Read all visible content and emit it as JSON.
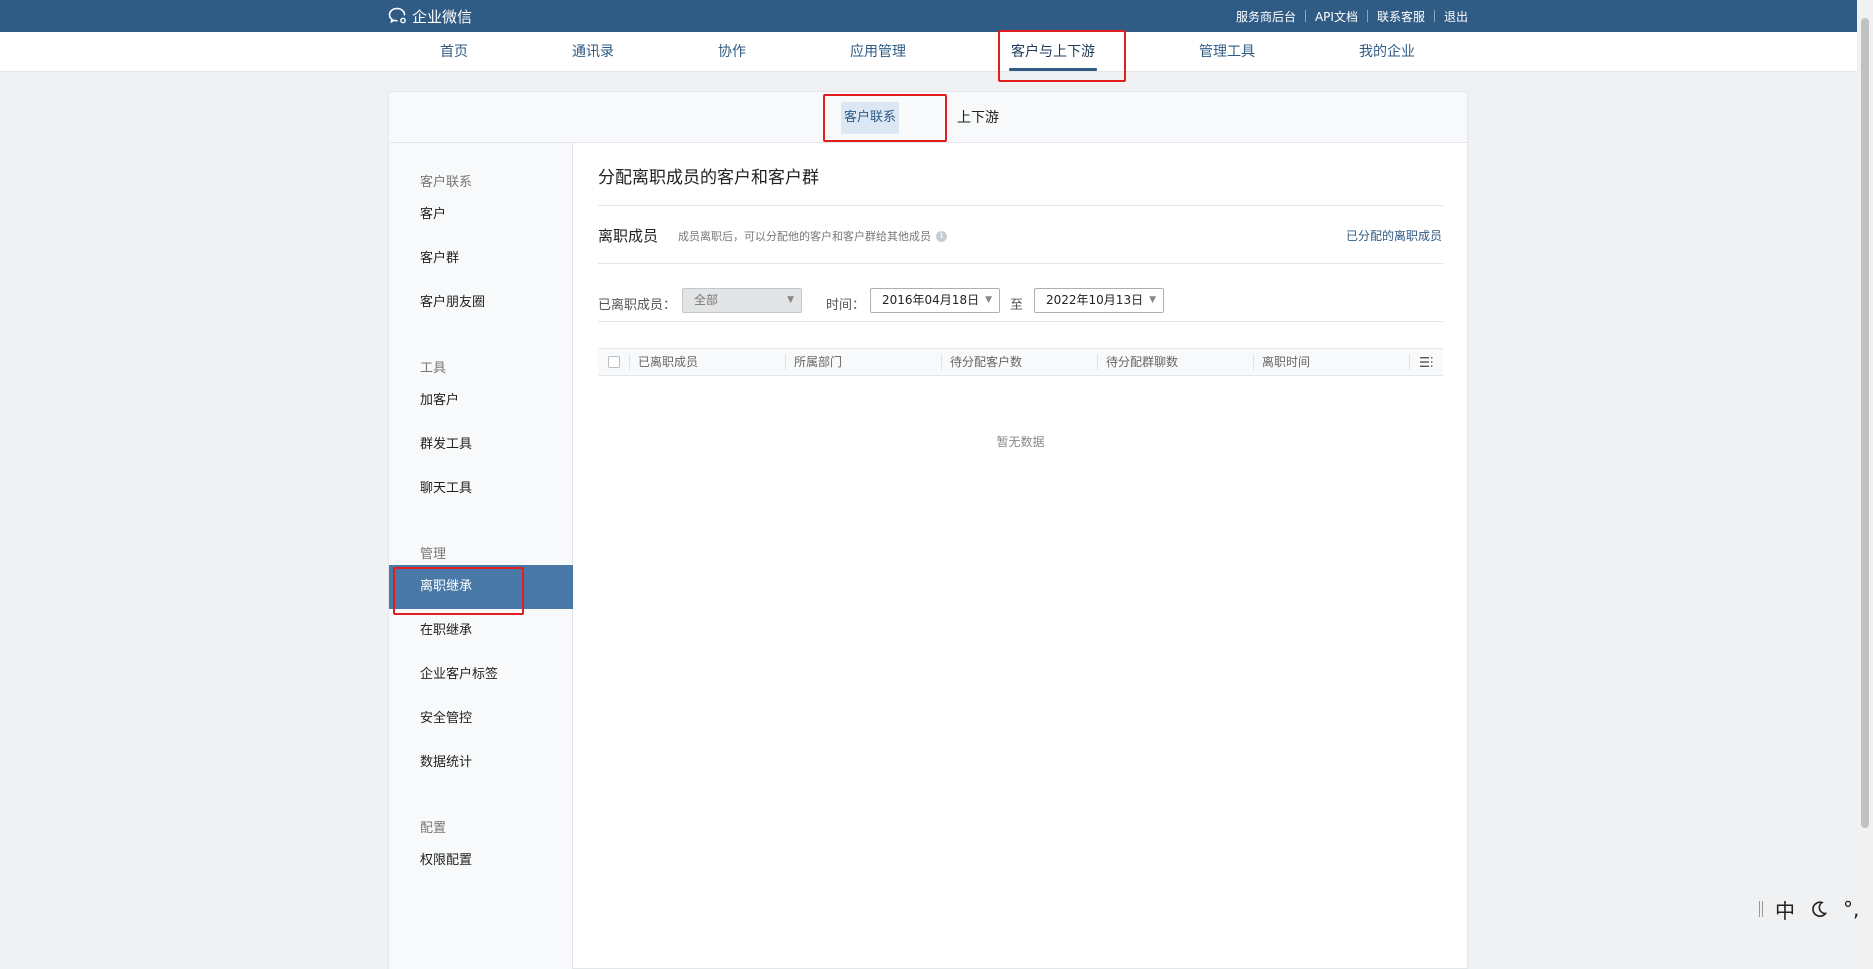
{
  "header": {
    "logo_text": "企业微信",
    "links": [
      "服务商后台",
      "API文档",
      "联系客服",
      "退出"
    ]
  },
  "nav": {
    "items": [
      "首页",
      "通讯录",
      "协作",
      "应用管理",
      "客户与上下游",
      "管理工具",
      "我的企业"
    ],
    "active": "客户与上下游"
  },
  "subnav": {
    "tabs": [
      "客户联系",
      "上下游"
    ],
    "active": "客户联系"
  },
  "sidebar": {
    "groups": [
      {
        "label": "客户联系",
        "items": [
          "客户",
          "客户群",
          "客户朋友圈"
        ]
      },
      {
        "label": "工具",
        "items": [
          "加客户",
          "群发工具",
          "聊天工具"
        ]
      },
      {
        "label": "管理",
        "items": [
          "离职继承",
          "在职继承",
          "企业客户标签",
          "安全管控",
          "数据统计"
        ]
      },
      {
        "label": "配置",
        "items": [
          "权限配置"
        ]
      }
    ],
    "active": "离职继承"
  },
  "main": {
    "title": "分配离职成员的客户和客户群",
    "section_title": "离职成员",
    "section_desc": "成员离职后，可以分配他的客户和客户群给其他成员",
    "section_link": "已分配的离职成员",
    "filter": {
      "member_label": "已离职成员：",
      "member_value": "全部",
      "time_label": "时间：",
      "start_date": "2016年04月18日",
      "to_label": "至",
      "end_date": "2022年10月13日"
    },
    "table": {
      "columns": [
        "已离职成员",
        "所属部门",
        "待分配客户数",
        "待分配群聊数",
        "离职时间"
      ],
      "empty_text": "暂无数据"
    }
  },
  "ime": {
    "glyphs": [
      "中",
      "°,"
    ]
  }
}
